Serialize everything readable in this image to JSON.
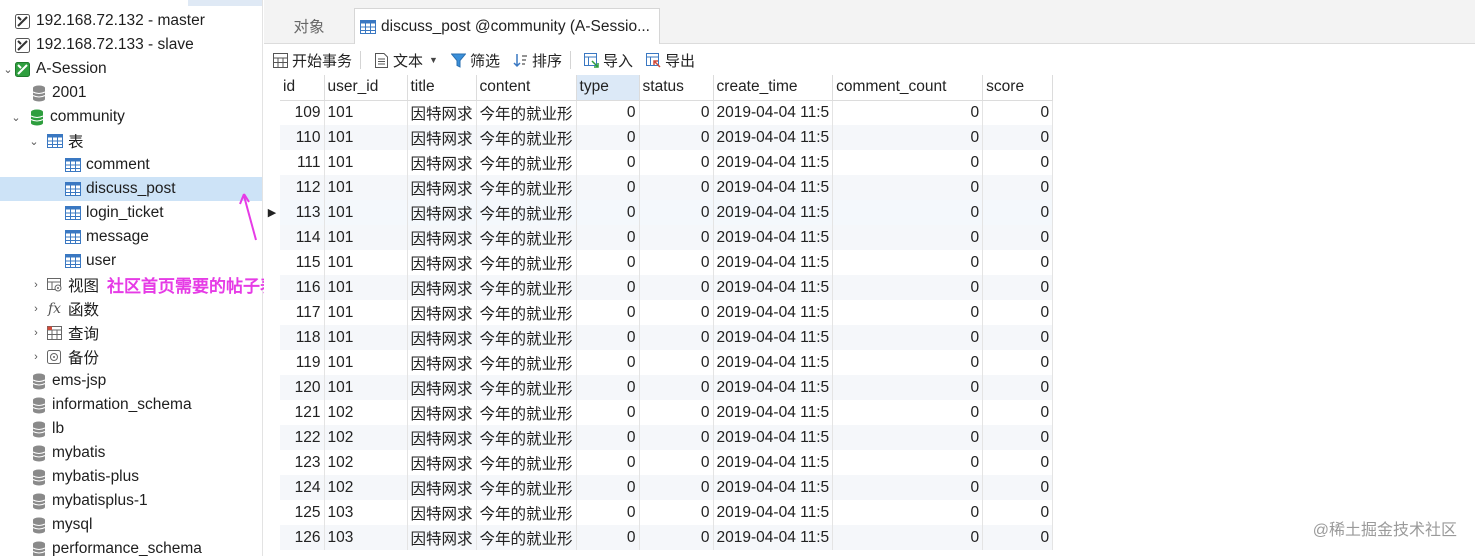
{
  "sidebar": {
    "connections": [
      {
        "label": "192.168.72.132 - master"
      },
      {
        "label": "192.168.72.133 - slave"
      },
      {
        "label": "A-Session"
      }
    ],
    "databases_top": [
      {
        "label": "2001"
      },
      {
        "label": "community"
      }
    ],
    "tables_group": "表",
    "tables": [
      {
        "label": "comment"
      },
      {
        "label": "discuss_post"
      },
      {
        "label": "login_ticket"
      },
      {
        "label": "message"
      },
      {
        "label": "user"
      }
    ],
    "groups": [
      {
        "label": "视图"
      },
      {
        "label": "函数"
      },
      {
        "label": "查询"
      },
      {
        "label": "备份"
      }
    ],
    "databases_bottom": [
      {
        "label": "ems-jsp"
      },
      {
        "label": "information_schema"
      },
      {
        "label": "lb"
      },
      {
        "label": "mybatis"
      },
      {
        "label": "mybatis-plus"
      },
      {
        "label": "mybatisplus-1"
      },
      {
        "label": "mysql"
      },
      {
        "label": "performance_schema"
      }
    ]
  },
  "tabs": {
    "objects": "对象",
    "table": "discuss_post @community (A-Sessio..."
  },
  "toolbar": {
    "begin_transaction": "开始事务",
    "text": "文本",
    "filter": "筛选",
    "sort": "排序",
    "import": "导入",
    "export": "导出"
  },
  "grid": {
    "columns": [
      "id",
      "user_id",
      "title",
      "content",
      "type",
      "status",
      "create_time",
      "comment_count",
      "score"
    ],
    "rows": [
      [
        "109",
        "101",
        "因特网求",
        "今年的就业形",
        "0",
        "0",
        "2019-04-04 11:5",
        "0",
        "0"
      ],
      [
        "110",
        "101",
        "因特网求",
        "今年的就业形",
        "0",
        "0",
        "2019-04-04 11:5",
        "0",
        "0"
      ],
      [
        "111",
        "101",
        "因特网求",
        "今年的就业形",
        "0",
        "0",
        "2019-04-04 11:5",
        "0",
        "0"
      ],
      [
        "112",
        "101",
        "因特网求",
        "今年的就业形",
        "0",
        "0",
        "2019-04-04 11:5",
        "0",
        "0"
      ],
      [
        "113",
        "101",
        "因特网求",
        "今年的就业形",
        "0",
        "0",
        "2019-04-04 11:5",
        "0",
        "0"
      ],
      [
        "114",
        "101",
        "因特网求",
        "今年的就业形",
        "0",
        "0",
        "2019-04-04 11:5",
        "0",
        "0"
      ],
      [
        "115",
        "101",
        "因特网求",
        "今年的就业形",
        "0",
        "0",
        "2019-04-04 11:5",
        "0",
        "0"
      ],
      [
        "116",
        "101",
        "因特网求",
        "今年的就业形",
        "0",
        "0",
        "2019-04-04 11:5",
        "0",
        "0"
      ],
      [
        "117",
        "101",
        "因特网求",
        "今年的就业形",
        "0",
        "0",
        "2019-04-04 11:5",
        "0",
        "0"
      ],
      [
        "118",
        "101",
        "因特网求",
        "今年的就业形",
        "0",
        "0",
        "2019-04-04 11:5",
        "0",
        "0"
      ],
      [
        "119",
        "101",
        "因特网求",
        "今年的就业形",
        "0",
        "0",
        "2019-04-04 11:5",
        "0",
        "0"
      ],
      [
        "120",
        "101",
        "因特网求",
        "今年的就业形",
        "0",
        "0",
        "2019-04-04 11:5",
        "0",
        "0"
      ],
      [
        "121",
        "102",
        "因特网求",
        "今年的就业形",
        "0",
        "0",
        "2019-04-04 11:5",
        "0",
        "0"
      ],
      [
        "122",
        "102",
        "因特网求",
        "今年的就业形",
        "0",
        "0",
        "2019-04-04 11:5",
        "0",
        "0"
      ],
      [
        "123",
        "102",
        "因特网求",
        "今年的就业形",
        "0",
        "0",
        "2019-04-04 11:5",
        "0",
        "0"
      ],
      [
        "124",
        "102",
        "因特网求",
        "今年的就业形",
        "0",
        "0",
        "2019-04-04 11:5",
        "0",
        "0"
      ],
      [
        "125",
        "103",
        "因特网求",
        "今年的就业形",
        "0",
        "0",
        "2019-04-04 11:5",
        "0",
        "0"
      ],
      [
        "126",
        "103",
        "因特网求",
        "今年的就业形",
        "0",
        "0",
        "2019-04-04 11:5",
        "0",
        "0"
      ]
    ],
    "current_row": 4
  },
  "annotation": "社区首页需要的帖子表",
  "watermark": "@稀土掘金技术社区",
  "colors": {
    "annotation": "#e63be6",
    "selection": "#cde3f7",
    "db_active": "#2e9e3e",
    "table_icon": "#3a78c2"
  }
}
